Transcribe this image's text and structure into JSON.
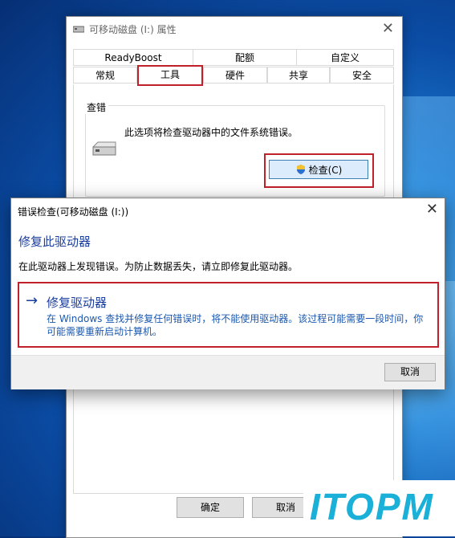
{
  "properties_window": {
    "title": "可移动磁盘 (I:) 属性",
    "tabs_row1": [
      "ReadyBoost",
      "配额",
      "自定义"
    ],
    "tabs_row2": [
      "常规",
      "工具",
      "硬件",
      "共享",
      "安全"
    ],
    "active_tab": "工具",
    "group_label": "查错",
    "group_text": "此选项将检查驱动器中的文件系统错误。",
    "check_button": "检查(C)",
    "ok_button": "确定",
    "cancel_button": "取消"
  },
  "dialog": {
    "title": "错误检查(可移动磁盘 (I:))",
    "heading": "修复此驱动器",
    "message": "在此驱动器上发现错误。为防止数据丢失，请立即修复此驱动器。",
    "option_title": "修复驱动器",
    "option_desc": "在 Windows 查找并修复任何错误时，将不能使用驱动器。该过程可能需要一段时间，你可能需要重新启动计算机。",
    "cancel_button": "取消"
  },
  "watermark": "ITOPM",
  "colors": {
    "highlight": "#c0202a",
    "link_blue": "#1a3e9e",
    "watermark": "#1ab0d8"
  }
}
